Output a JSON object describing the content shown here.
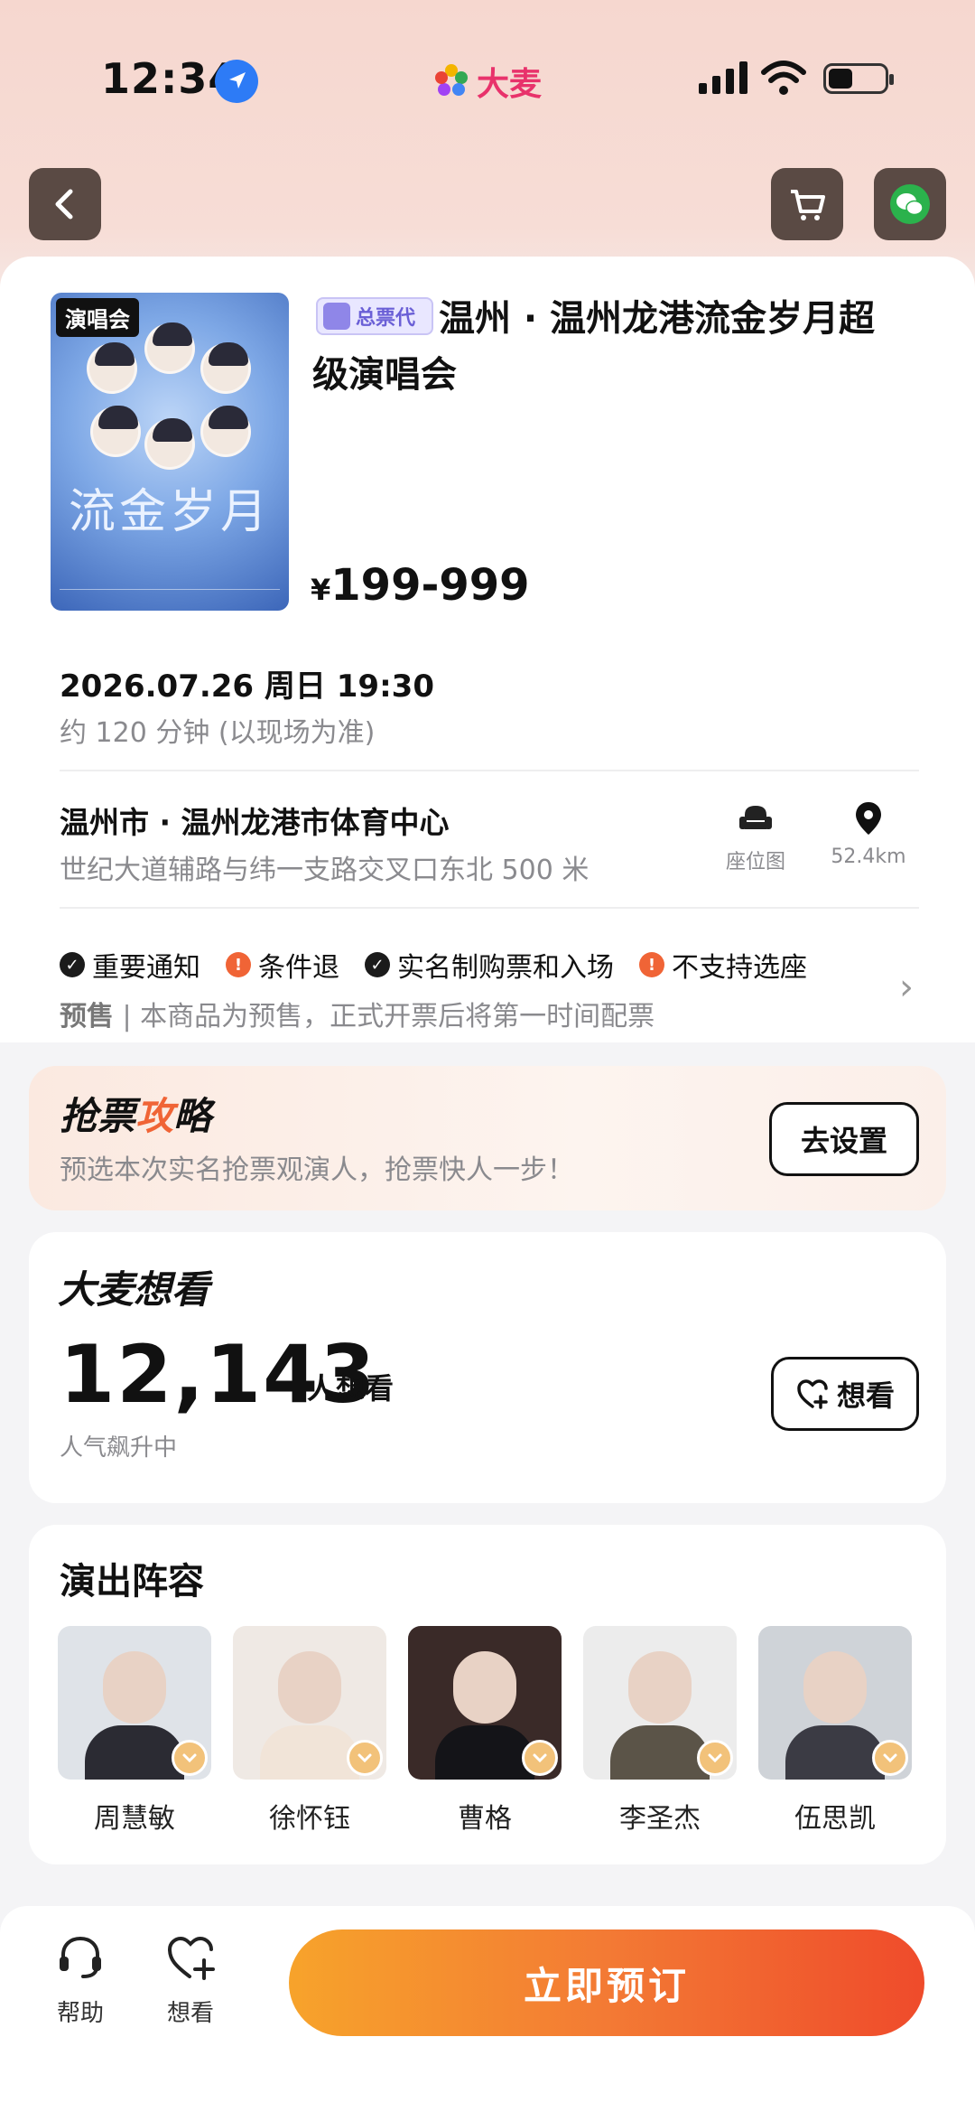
{
  "status_bar": {
    "time": "12:34",
    "brand": "大麦"
  },
  "event": {
    "poster_tag": "演唱会",
    "poster_title": "流金岁月",
    "agent_badge": "总票代",
    "title": "温州 · 温州龙港流金岁月超级演唱会",
    "price_currency": "¥",
    "price_range": "199-999",
    "datetime": "2026.07.26 周日 19:30",
    "duration": "约 120 分钟 (以现场为准)",
    "venue": "温州市 · 温州龙港市体育中心",
    "address": "世纪大道辅路与纬一支路交叉口东北 500 米",
    "seatmap_label": "座位图",
    "distance": "52.4km",
    "notices": [
      {
        "label": "重要通知",
        "kind": "ok"
      },
      {
        "label": "条件退",
        "kind": "warn"
      },
      {
        "label": "实名制购票和入场",
        "kind": "ok"
      },
      {
        "label": "不支持选座",
        "kind": "warn"
      }
    ],
    "presale_tag": "预售",
    "presale_text": " | 本商品为预售，正式开票后将第一时间配票"
  },
  "strategy": {
    "title_a": "抢票",
    "title_accent": "攻",
    "title_b": "略",
    "subtitle": "预选本次实名抢票观演人，抢票快人一步！",
    "button": "去设置"
  },
  "want": {
    "title": "大麦想看",
    "count": "12,143",
    "unit": "人想看",
    "subtitle": "人气飙升中",
    "button": "想看"
  },
  "cast": {
    "title": "演出阵容",
    "members": [
      {
        "name": "周慧敏",
        "bg": "#dfe3e8",
        "body": "#2b2b33"
      },
      {
        "name": "徐怀钰",
        "bg": "#efe9e4",
        "body": "#f1e4d8"
      },
      {
        "name": "曹格",
        "bg": "#3a2a28",
        "body": "#141418"
      },
      {
        "name": "李圣杰",
        "bg": "#ececec",
        "body": "#5b5448"
      },
      {
        "name": "伍思凯",
        "bg": "#cfd3d8",
        "body": "#3b3b44"
      }
    ]
  },
  "bottom": {
    "help": "帮助",
    "want": "想看",
    "book": "立即预订"
  },
  "colors": {
    "accent": "#f06436",
    "brand": "#e8326b"
  }
}
